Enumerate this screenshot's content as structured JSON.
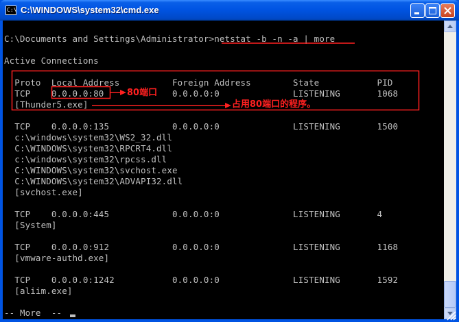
{
  "window": {
    "title": "C:\\WINDOWS\\system32\\cmd.exe",
    "icon_label": "C:\\"
  },
  "console": {
    "lines": [
      "C:\\Documents and Settings\\Administrator>netstat -b -n -a | more",
      "",
      "Active Connections",
      "",
      "  Proto  Local Address          Foreign Address        State           PID",
      "  TCP    0.0.0.0:80             0.0.0.0:0              LISTENING       1068",
      "  [Thunder5.exe]",
      "",
      "  TCP    0.0.0.0:135            0.0.0.0:0              LISTENING       1500",
      "  c:\\windows\\system32\\WS2_32.dll",
      "  C:\\WINDOWS\\system32\\RPCRT4.dll",
      "  c:\\windows\\system32\\rpcss.dll",
      "  C:\\WINDOWS\\system32\\svchost.exe",
      "  C:\\WINDOWS\\system32\\ADVAPI32.dll",
      "  [svchost.exe]",
      "",
      "  TCP    0.0.0.0:445            0.0.0.0:0              LISTENING       4",
      "  [System]",
      "",
      "  TCP    0.0.0.0:912            0.0.0.0:0              LISTENING       1168",
      "  [vmware-authd.exe]",
      "",
      "  TCP    0.0.0.0:1242           0.0.0.0:0              LISTENING       1592",
      "  [aliim.exe]",
      "",
      "-- More  --"
    ]
  },
  "annotations": {
    "port_note": "80端口",
    "program_note": "占用80端口的程序。"
  },
  "colors": {
    "console_bg": "#000000",
    "console_text": "#c0c0c0",
    "annotation": "#ff2020",
    "titlebar": "#0054e3"
  },
  "icons": [
    "cmd-app-icon",
    "minimize-icon",
    "maximize-icon",
    "close-icon",
    "scroll-up-icon",
    "scroll-down-icon",
    "resize-grip-icon"
  ]
}
